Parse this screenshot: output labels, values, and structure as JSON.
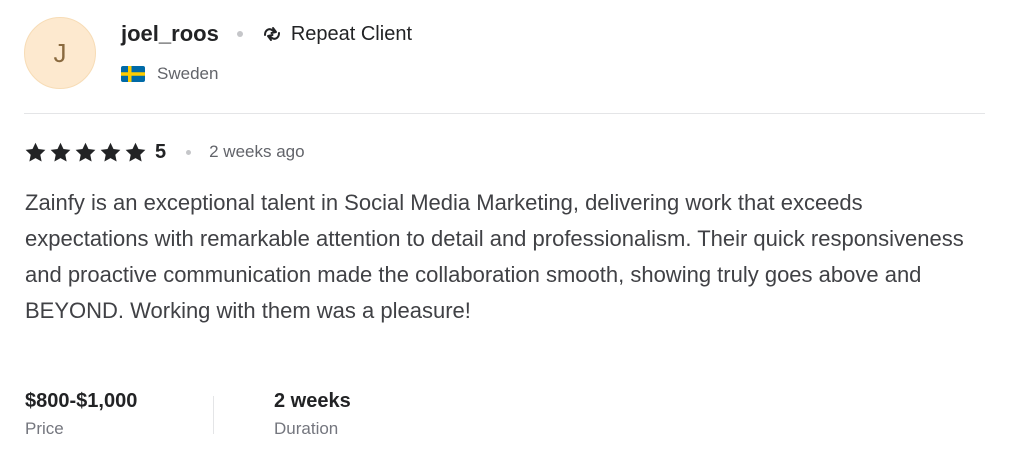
{
  "reviewer": {
    "avatar_initial": "J",
    "username": "joel_roos",
    "badge_label": "Repeat Client",
    "badge_icon": "repeat-icon",
    "country": "Sweden",
    "flag_icon": "sweden-flag-icon"
  },
  "rating": {
    "stars_filled": 5,
    "stars_total": 5,
    "value": "5",
    "time_ago": "2 weeks ago"
  },
  "review": {
    "text": "Zainfy is an exceptional talent in Social Media Marketing, delivering work that exceeds expectations with remarkable attention to detail and professionalism. Their quick responsiveness and proactive communication made the collaboration smooth, showing truly goes above and BEYOND. Working with them was a pleasure!"
  },
  "meta": {
    "price_value": "$800-$1,000",
    "price_label": "Price",
    "duration_value": "2 weeks",
    "duration_label": "Duration"
  },
  "colors": {
    "avatar_bg": "#fde9cf",
    "text_primary": "#222325",
    "text_secondary": "#62646a",
    "star": "#222325",
    "flag_blue": "#006AA7",
    "flag_yellow": "#FECC00"
  }
}
